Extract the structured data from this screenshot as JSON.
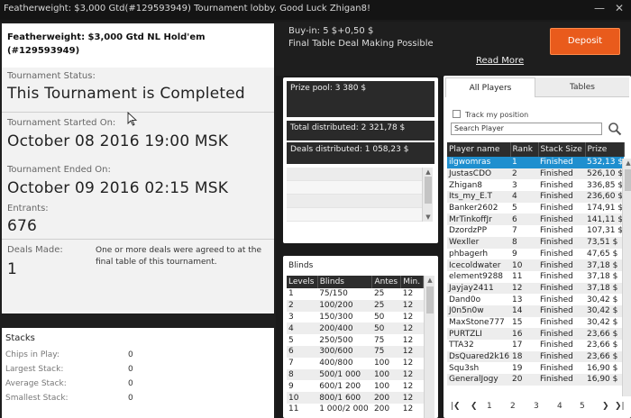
{
  "window": {
    "title": "Featherweight: $3,000 Gtd(#129593949) Tournament lobby. Good Luck Zhigan8!",
    "minimize": "—",
    "close": "✕"
  },
  "header": {
    "title": "Featherweight: $3,000 Gtd NL Hold'em (#129593949)"
  },
  "info": {
    "status_label": "Tournament Status:",
    "status_value": "This Tournament is Completed",
    "started_label": "Tournament Started On:",
    "started_value": "October 08 2016  19:00 MSK",
    "ended_label": "Tournament Ended On:",
    "ended_value": "October 09 2016  02:15 MSK",
    "entrants_label": "Entrants:",
    "entrants_value": "676",
    "deals_label": "Deals Made:",
    "deals_value": "1",
    "deals_note": "One or more deals were agreed to at the final table of this tournament."
  },
  "stacks": {
    "title": "Stacks",
    "rows": [
      {
        "label": "Chips in Play:",
        "value": "0"
      },
      {
        "label": "Largest Stack:",
        "value": "0"
      },
      {
        "label": "Average Stack:",
        "value": "0"
      },
      {
        "label": "Smallest Stack:",
        "value": "0"
      }
    ]
  },
  "top": {
    "buyin": "Buy-in: 5 $+0,50 $",
    "subtitle": "Final Table Deal Making Possible",
    "read_more": "Read More",
    "deposit": "Deposit"
  },
  "prize": {
    "pool": "Prize pool: 3 380 $",
    "total": "Total distributed: 2 321,78 $",
    "deals": "Deals distributed: 1 058,23 $"
  },
  "blinds": {
    "title": "Blinds",
    "headers": [
      "Levels",
      "Blinds",
      "Antes",
      "Min."
    ],
    "rows": [
      [
        "1",
        "75/150",
        "25",
        "12"
      ],
      [
        "2",
        "100/200",
        "25",
        "12"
      ],
      [
        "3",
        "150/300",
        "50",
        "12"
      ],
      [
        "4",
        "200/400",
        "50",
        "12"
      ],
      [
        "5",
        "250/500",
        "75",
        "12"
      ],
      [
        "6",
        "300/600",
        "75",
        "12"
      ],
      [
        "7",
        "400/800",
        "100",
        "12"
      ],
      [
        "8",
        "500/1 000",
        "100",
        "12"
      ],
      [
        "9",
        "600/1 200",
        "100",
        "12"
      ],
      [
        "10",
        "800/1 600",
        "200",
        "12"
      ],
      [
        "11",
        "1 000/2 000",
        "200",
        "12"
      ]
    ]
  },
  "players": {
    "tab_all": "All Players",
    "tab_tables": "Tables",
    "track_label": "Track my position",
    "search_placeholder": "Search Player",
    "headers": [
      "Player name",
      "Rank",
      "Stack Size",
      "Prize"
    ],
    "rows": [
      [
        "ilgwomras",
        "1",
        "Finished",
        "532,13 $"
      ],
      [
        "JustasCDO",
        "2",
        "Finished",
        "526,10 $"
      ],
      [
        "Zhigan8",
        "3",
        "Finished",
        "336,85 $"
      ],
      [
        "Its_my_E.T",
        "4",
        "Finished",
        "236,60 $"
      ],
      [
        "Banker2602",
        "5",
        "Finished",
        "174,91 $"
      ],
      [
        "MrTinkoffJr",
        "6",
        "Finished",
        "141,11 $"
      ],
      [
        "DzordzPP",
        "7",
        "Finished",
        "107,31 $"
      ],
      [
        "Wexller",
        "8",
        "Finished",
        "73,51 $"
      ],
      [
        "phbagerh",
        "9",
        "Finished",
        "47,65 $"
      ],
      [
        "Icecoldwater",
        "10",
        "Finished",
        "37,18 $"
      ],
      [
        "element9288",
        "11",
        "Finished",
        "37,18 $"
      ],
      [
        "Jayjay2411",
        "12",
        "Finished",
        "37,18 $"
      ],
      [
        "Dand0o",
        "13",
        "Finished",
        "30,42 $"
      ],
      [
        "J0n5n0w",
        "14",
        "Finished",
        "30,42 $"
      ],
      [
        "MaxStone777",
        "15",
        "Finished",
        "30,42 $"
      ],
      [
        "PURTZLI",
        "16",
        "Finished",
        "23,66 $"
      ],
      [
        "TTA32",
        "17",
        "Finished",
        "23,66 $"
      ],
      [
        "DsQuared2k16",
        "18",
        "Finished",
        "23,66 $"
      ],
      [
        "Squ3sh",
        "19",
        "Finished",
        "16,90 $"
      ],
      [
        "GeneralJogy",
        "20",
        "Finished",
        "16,90 $"
      ]
    ],
    "pager": {
      "first": "|❮",
      "prev": "❮",
      "pages": [
        "1",
        "2",
        "3",
        "4",
        "5"
      ],
      "next": "❯",
      "last": "❯|"
    }
  }
}
